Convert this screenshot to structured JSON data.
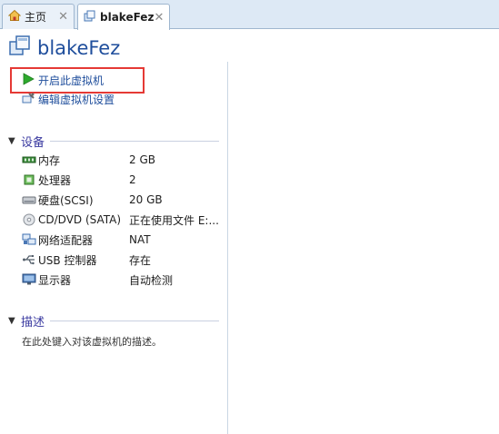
{
  "tabs": [
    {
      "label": "主页",
      "icon": "home-icon",
      "active": false
    },
    {
      "label": "blakeFez",
      "icon": "vm-icon",
      "active": true
    }
  ],
  "header": {
    "vm_name": "blakeFez"
  },
  "actions": {
    "power_on": "开启此虚拟机",
    "edit_settings": "编辑虚拟机设置"
  },
  "devices": {
    "title": "设备",
    "items": [
      {
        "name": "内存",
        "value": "2 GB",
        "icon": "memory-icon"
      },
      {
        "name": "处理器",
        "value": "2",
        "icon": "cpu-icon"
      },
      {
        "name": "硬盘(SCSI)",
        "value": "20 GB",
        "icon": "hard-disk-icon"
      },
      {
        "name": "CD/DVD (SATA)",
        "value": "正在使用文件 E:...",
        "icon": "cd-dvd-icon"
      },
      {
        "name": "网络适配器",
        "value": "NAT",
        "icon": "network-adapter-icon"
      },
      {
        "name": "USB 控制器",
        "value": "存在",
        "icon": "usb-icon"
      },
      {
        "name": "显示器",
        "value": "自动检测",
        "icon": "monitor-icon"
      }
    ]
  },
  "description": {
    "title": "描述",
    "placeholder": "在此处键入对该虚拟机的描述。"
  },
  "colors": {
    "accent": "#1f4e9c",
    "highlight": "#e53935",
    "play": "#2eaa2e"
  }
}
